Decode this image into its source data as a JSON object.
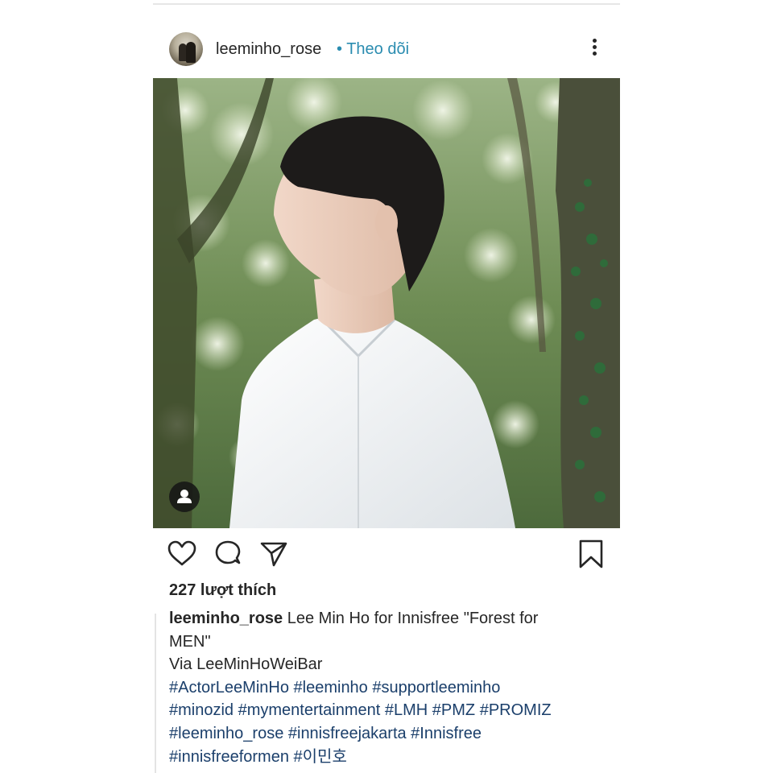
{
  "post": {
    "username": "leeminho_rose",
    "separator": "•",
    "follow_label": "Theo dõi",
    "likes_text": "227 lượt thích",
    "caption": {
      "username": "leeminho_rose",
      "text_line1": "Lee Min Ho for Innisfree \"Forest for",
      "text_line2": "MEN\"",
      "text_line3": "Via LeeMinHoWeiBar",
      "hashtag_lines": [
        "#ActorLeeMinHo #leeminho #supportleeminho",
        "#minozid #mymentertainment #LMH #PMZ #PROMIZ",
        "#leeminho_rose #innisfreejakarta #Innisfree",
        "#innisfreeformen #이민호"
      ]
    }
  },
  "icons": {
    "more": "more-vertical-icon",
    "like": "heart-icon",
    "comment": "comment-icon",
    "share": "paper-plane-icon",
    "save": "bookmark-icon",
    "tag_people": "person-icon"
  },
  "colors": {
    "follow": "#2a8cb0",
    "text": "#262626",
    "hashtag": "#1b3f6b"
  }
}
